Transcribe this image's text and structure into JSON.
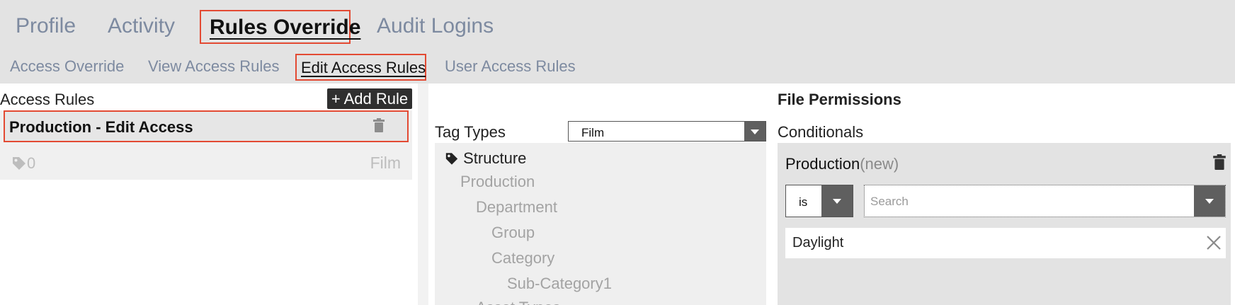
{
  "main_tabs": [
    {
      "label": "Profile",
      "active": false
    },
    {
      "label": "Activity",
      "active": false
    },
    {
      "label": "Rules Override",
      "active": true
    },
    {
      "label": "Audit Logins",
      "active": false
    }
  ],
  "sub_tabs": [
    {
      "label": "Access Override",
      "active": false
    },
    {
      "label": "View Access Rules",
      "active": false
    },
    {
      "label": "Edit Access Rules",
      "active": true
    },
    {
      "label": "User Access Rules",
      "active": false
    }
  ],
  "access_rules": {
    "title": "Access Rules",
    "add_label": "+ Add Rule",
    "rule": {
      "name": "Production - Edit Access",
      "tag_count": "0",
      "tag_type": "Film"
    }
  },
  "tag_types": {
    "label": "Tag Types",
    "selected": "Film",
    "tree": [
      "Structure",
      "Production",
      "Department",
      "Group",
      "Category",
      "Sub-Category1",
      "Asset Types"
    ]
  },
  "file_permissions": {
    "title": "File Permissions",
    "conditionals_label": "Conditionals",
    "conditional": {
      "name": "Production",
      "status": "(new)",
      "operator": "is",
      "search_placeholder": "Search",
      "value": "Daylight"
    }
  },
  "colors": {
    "highlight_border": "#e34a33",
    "tab_inactive": "#7d8aa0",
    "caret_bg": "#5f5f5f"
  },
  "icons": [
    "tag-icon",
    "trash-icon",
    "close-icon",
    "chevron-down-icon"
  ]
}
